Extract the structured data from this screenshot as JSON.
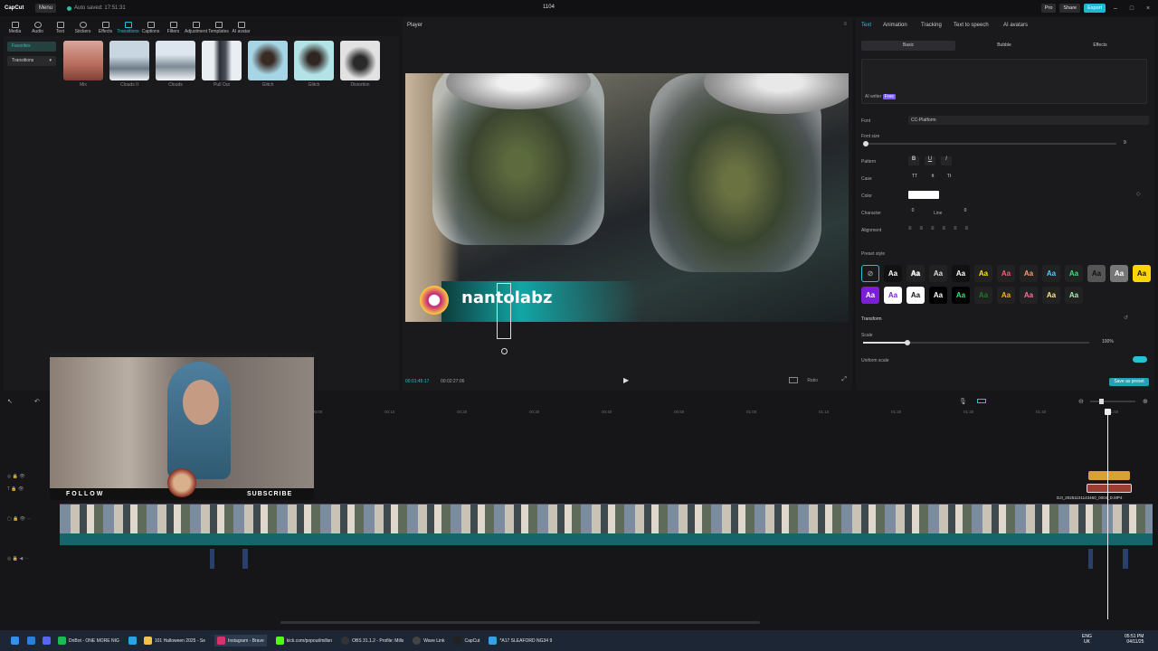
{
  "app": {
    "logo": "CapCut",
    "menu": "Menu",
    "autosave": "Auto saved: 17:51:31",
    "project_title": "1104",
    "pro": "Pro",
    "share": "Share",
    "export": "Export"
  },
  "toolbar": {
    "items": [
      "Media",
      "Audio",
      "Text",
      "Stickers",
      "Effects",
      "Transitions",
      "Captions",
      "Filters",
      "Adjustment",
      "Templates",
      "AI avatar"
    ],
    "active": "Transitions"
  },
  "left_panel": {
    "side_items": [
      "Favorites",
      "Transitions"
    ],
    "transitions": [
      "Mix",
      "Clouds II",
      "Clouds",
      "Pull Out",
      "Glitch",
      "Glitch",
      "Distortion"
    ]
  },
  "player": {
    "title": "Player",
    "current_time": "00:01:45:17",
    "total_time": "00:02:27:06",
    "overlay_text": "nantolabz",
    "ratio": "Ratio"
  },
  "right_panel": {
    "tabs": [
      "Text",
      "Animation",
      "Tracking",
      "Text to speech",
      "AI avatars"
    ],
    "subtabs": [
      "Basic",
      "Bubble",
      "Effects"
    ],
    "ai_writer": "AI writer",
    "ai_badge": "Free",
    "font_label": "Font",
    "font_value": "CC-Platform",
    "font_size_label": "Font size",
    "font_size_value": "9",
    "pattern_label": "Pattern",
    "pattern_opts": [
      "B",
      "U",
      "I"
    ],
    "case_label": "Case",
    "case_opts": [
      "TT",
      "tt",
      "Tt"
    ],
    "color_label": "Color",
    "character_label": "Character",
    "character_value": "0",
    "line_label": "Line",
    "line_value": "0",
    "alignment_label": "Alignment",
    "preset_label": "Preset style",
    "preset_text": "Aa",
    "transform_label": "Transform",
    "scale_label": "Scale",
    "scale_value": "100%",
    "uniform_label": "Uniform scale",
    "save_preset": "Save as preset"
  },
  "overlay": {
    "follow": "FOLLOW",
    "subscribe": "SUBSCRIBE"
  },
  "timeline": {
    "ruler": [
      "00:00",
      "00:10",
      "00:20",
      "00:30",
      "00:40",
      "00:50",
      "01:00",
      "01:10",
      "01:20",
      "01:30",
      "01:40",
      "01:50"
    ],
    "clip_name": "DJI_20251101143460_0004_D.MP4"
  },
  "taskbar": {
    "items": [
      "DnBot - ONE MORE NIG",
      "101 Halloween 2025 - Se",
      "Instagram - Brave",
      "kick.com/popout/millsn",
      "OBS 31.1.2 - Profile: Mills",
      "Wave Link",
      "CapCut",
      "*A17 SLEAFORD NG34 9"
    ],
    "lang": "ENG",
    "lang2": "UK",
    "time": "05:51 PM",
    "date": "04/11/25"
  }
}
